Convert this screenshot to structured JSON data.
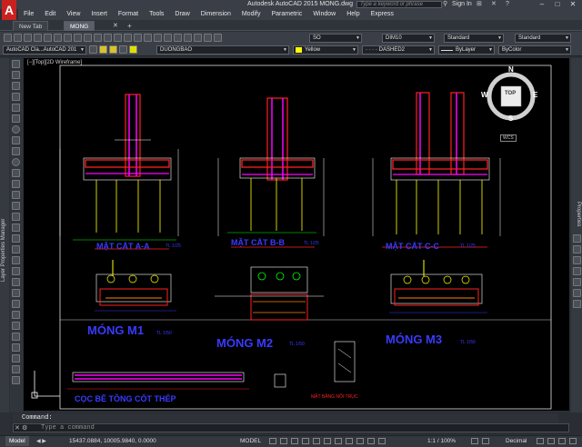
{
  "app": {
    "title": "Autodesk AutoCAD 2015   MONG.dwg",
    "logo": "A",
    "search_placeholder": "Type a keyword or phrase",
    "sign_in": "Sign In",
    "window_buttons": [
      "–",
      "□",
      "✕"
    ]
  },
  "menu": [
    "File",
    "Edit",
    "View",
    "Insert",
    "Format",
    "Tools",
    "Draw",
    "Dimension",
    "Modify",
    "Parametric",
    "Window",
    "Help",
    "Express"
  ],
  "tabs": [
    {
      "label": "New Tab",
      "active": false
    },
    {
      "label": "MONG",
      "active": true
    }
  ],
  "toolbar1": {
    "text_style": "SO",
    "dim_style": "DIM10",
    "table_style": "Standard",
    "multileader_style": "Standard"
  },
  "toolbar2": {
    "workspace": "AutoCAD Cla...AutoCAD 201",
    "layer": "DUONGBAO",
    "color": "Yellow",
    "linetype": "DASHED2",
    "lineweight": "ByLayer",
    "plotstyle": "ByColor"
  },
  "viewport": {
    "label": "[−][Top][2D Wireframe]"
  },
  "viewcube": {
    "north": "N",
    "south": "S",
    "east": "E",
    "west": "W",
    "face": "TOP",
    "ucs": "WCS"
  },
  "palettes": {
    "left": "Layer Properties Manager",
    "right": "Properties"
  },
  "drawing_labels": {
    "section_a": "MẶT CẮT A-A",
    "section_b": "MẶT CẮT B-B",
    "section_c": "MẶT CẮT C-C",
    "scale_small": "TL 1/25",
    "mong1": "MÓNG M1",
    "mong2": "MÓNG M2",
    "mong3": "MÓNG M3",
    "scale_mong": "TL 1/50",
    "pile": "CỌC BÊ TÔNG CỐT THÉP",
    "pile_joint": "MẶT BẰNG NỐI TRỤC"
  },
  "command": {
    "history": "Command:",
    "placeholder": "Type a command"
  },
  "status": {
    "model_tab": "Model",
    "coords": "15437.0884, 10005.9840, 0.0000",
    "model_label": "MODEL",
    "scale": "1:1 / 100%",
    "units": "Decimal"
  },
  "colors": {
    "magenta": "#ff00ff",
    "yellow": "#ffff00",
    "red": "#ff2020",
    "blue": "#3a3aff",
    "white": "#ffffff",
    "green": "#00ff00",
    "cyan": "#00ffff",
    "orange": "#ff8000"
  }
}
